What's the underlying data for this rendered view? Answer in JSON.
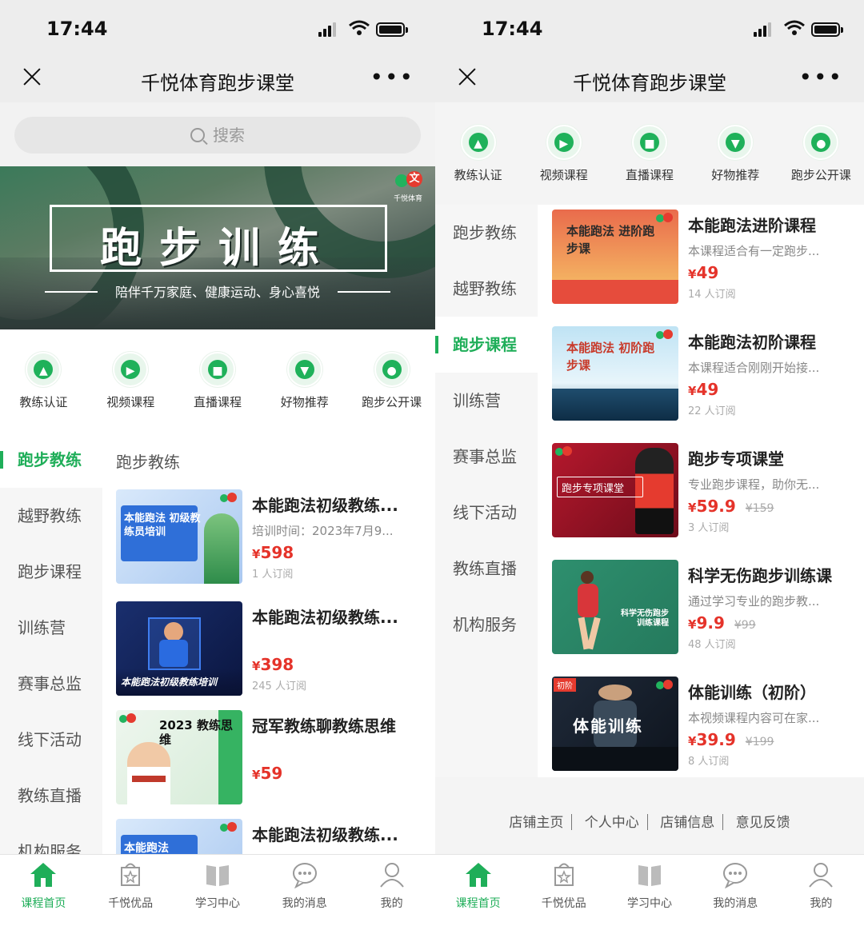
{
  "status": {
    "time": "17:44"
  },
  "nav": {
    "title": "千悦体育跑步课堂"
  },
  "search": {
    "placeholder": "搜索"
  },
  "banner": {
    "title": "跑步训练",
    "subtitle": "陪伴千万家庭、健康运动、身心喜悦",
    "logo_text": "千悦体育"
  },
  "quick_icons": [
    {
      "label": "教练认证",
      "icon": "coach-cert-icon"
    },
    {
      "label": "视频课程",
      "icon": "video-icon"
    },
    {
      "label": "直播课程",
      "icon": "live-camera-icon"
    },
    {
      "label": "好物推荐",
      "icon": "cart-icon"
    },
    {
      "label": "跑步公开课",
      "icon": "open-class-icon"
    }
  ],
  "categories": [
    "跑步教练",
    "越野教练",
    "跑步课程",
    "训练营",
    "赛事总监",
    "线下活动",
    "教练直播",
    "机构服务"
  ],
  "left": {
    "section_title": "跑步教练",
    "courses": [
      {
        "title": "本能跑法初级教练...",
        "desc": "培训时间：2023年7月9...",
        "price": "598",
        "subs": "1 人订阅",
        "thumb_text": "本能跑法 初级教练员培训"
      },
      {
        "title": "本能跑法初级教练...",
        "desc": "",
        "price": "398",
        "subs": "245 人订阅",
        "thumb_text": "本能跑法初级教练培训"
      },
      {
        "title": "冠军教练聊教练思维",
        "desc": "",
        "price": "59",
        "subs": "",
        "thumb_text": "2023 教练思维"
      },
      {
        "title": "本能跑法初级教练...",
        "desc": "",
        "price": "",
        "subs": "",
        "thumb_text": "本能跑法"
      }
    ]
  },
  "right": {
    "courses": [
      {
        "title": "本能跑法进阶课程",
        "desc": "本课程适合有一定跑步...",
        "price": "49",
        "orig": "",
        "subs": "14 人订阅",
        "thumb_text": "本能跑法 进阶跑步课"
      },
      {
        "title": "本能跑法初阶课程",
        "desc": "本课程适合刚刚开始接...",
        "price": "49",
        "orig": "",
        "subs": "22 人订阅",
        "thumb_text": "本能跑法 初阶跑步课"
      },
      {
        "title": "跑步专项课堂",
        "desc": "专业跑步课程，助你无...",
        "price": "59.9",
        "orig": "¥159",
        "subs": "3 人订阅",
        "thumb_text": "跑步专项课堂"
      },
      {
        "title": "科学无伤跑步训练课",
        "desc": "通过学习专业的跑步教...",
        "price": "9.9",
        "orig": "¥99",
        "subs": "48 人订阅",
        "thumb_text": "科学无伤跑步训练课程"
      },
      {
        "title": "体能训练（初阶）",
        "desc": "本视频课程内容可在家...",
        "price": "39.9",
        "orig": "¥199",
        "subs": "8 人订阅",
        "thumb_text": "体能训练"
      }
    ],
    "footer_links": [
      "店铺主页",
      "个人中心",
      "店铺信息",
      "意见反馈"
    ]
  },
  "tabs": [
    {
      "label": "课程首页",
      "icon": "home-icon"
    },
    {
      "label": "千悦优品",
      "icon": "shop-icon"
    },
    {
      "label": "学习中心",
      "icon": "book-icon"
    },
    {
      "label": "我的消息",
      "icon": "message-icon"
    },
    {
      "label": "我的",
      "icon": "user-icon"
    }
  ],
  "colors": {
    "accent": "#1fae59",
    "price": "#e5332a"
  }
}
